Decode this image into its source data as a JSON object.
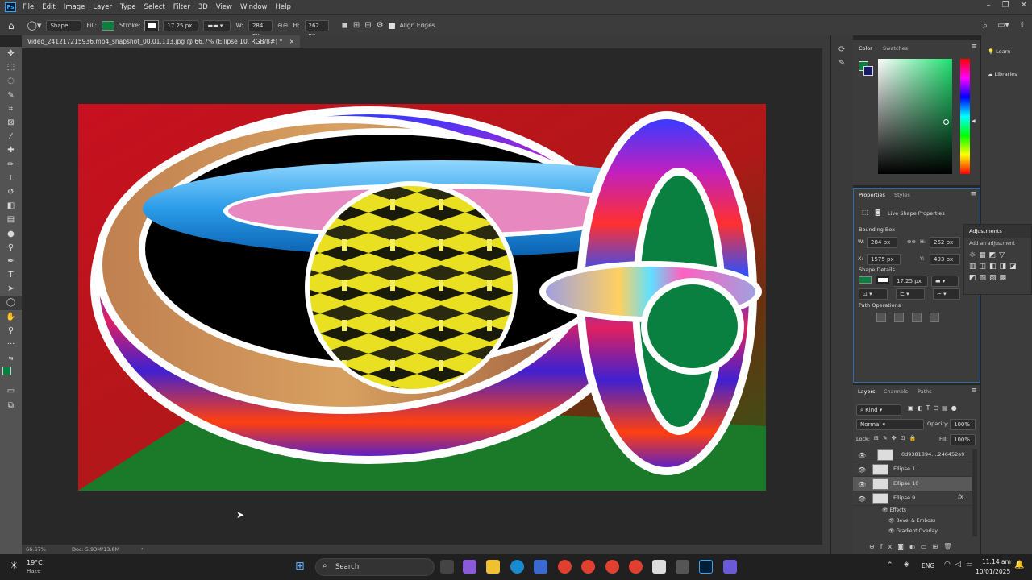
{
  "menubar": {
    "logo": "Ps",
    "items": [
      "File",
      "Edit",
      "Image",
      "Layer",
      "Type",
      "Select",
      "Filter",
      "3D",
      "View",
      "Window",
      "Help"
    ]
  },
  "options": {
    "mode": "Shape",
    "fill_label": "Fill:",
    "stroke_label": "Stroke:",
    "stroke_width": "17.25 px",
    "w_label": "W:",
    "w_value": "284 px",
    "h_label": "H:",
    "h_value": "262 px",
    "align_edges": "Align Edges",
    "fill_color": "#0a8040"
  },
  "document": {
    "tab_title": "Video_241217215936.mp4_snapshot_00.01.113.jpg @ 66.7% (Ellipse 10, RGB/8#) *",
    "zoom": "66.67%",
    "doc_size": "Doc: 5.93M/13.8M"
  },
  "color_panel": {
    "tabs": [
      "Color",
      "Swatches"
    ],
    "foreground": "#0a8040",
    "background": "#1a1a6a"
  },
  "learn_panel": {
    "items": [
      "Learn",
      "Libraries"
    ]
  },
  "properties": {
    "tabs": [
      "Properties",
      "Styles"
    ],
    "subtitle": "Live Shape Properties",
    "bbox_title": "Bounding Box",
    "w_label": "W:",
    "w_value": "284 px",
    "h_label": "H:",
    "h_value": "262 px",
    "x_label": "X:",
    "x_value": "1575 px",
    "y_label": "Y:",
    "y_value": "493 px",
    "shape_details": "Shape Details",
    "stroke_value": "17.25 px",
    "path_ops": "Path Operations"
  },
  "adjustments": {
    "title": "Adjustments",
    "subtitle": "Add an adjustment"
  },
  "layers": {
    "tabs": [
      "Layers",
      "Channels",
      "Paths"
    ],
    "filter": "Kind",
    "blend": "Normal",
    "opacity_label": "Opacity:",
    "opacity": "100%",
    "lock_label": "Lock:",
    "fill_label": "Fill:",
    "fill": "100%",
    "rows": [
      {
        "name": "0d9381894....246452e9"
      },
      {
        "name": "Ellipse 1..."
      },
      {
        "name": "Ellipse 10"
      },
      {
        "name": "Ellipse 9"
      }
    ],
    "effects_label": "Effects",
    "effect1": "Bevel & Emboss",
    "effect2": "Gradient Overlay",
    "fx": "fx"
  },
  "taskbar": {
    "weather_temp": "19°C",
    "weather_desc": "Haze",
    "search": "Search",
    "lang": "ENG",
    "time": "11:14 am",
    "date": "10/01/2025"
  }
}
